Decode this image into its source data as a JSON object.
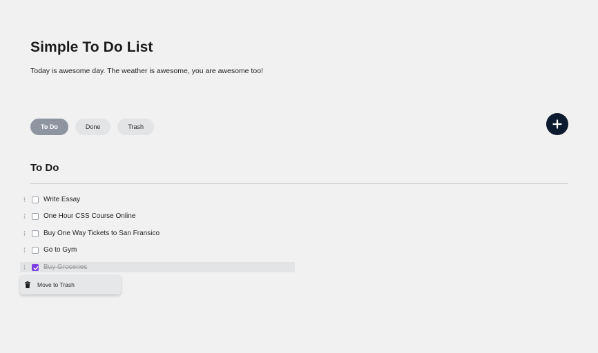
{
  "header": {
    "title": "Simple To Do List",
    "subtitle": "Today is awesome day. The weather is awesome, you are awesome too!"
  },
  "tabs": [
    {
      "label": "To Do",
      "active": true
    },
    {
      "label": "Done",
      "active": false
    },
    {
      "label": "Trash",
      "active": false
    }
  ],
  "add_button": {
    "icon": "plus-icon"
  },
  "section": {
    "title": "To Do"
  },
  "tasks": [
    {
      "label": "Write Essay",
      "checked": false
    },
    {
      "label": "One Hour CSS Course Online",
      "checked": false
    },
    {
      "label": "Buy One Way Tickets to San Fransico",
      "checked": false
    },
    {
      "label": "Go to Gym",
      "checked": false
    },
    {
      "label": "Buy Groceries",
      "checked": true
    }
  ],
  "context_menu": {
    "icon": "trash-icon",
    "label": "Move to Trash"
  },
  "colors": {
    "background": "#f1f1f1",
    "accent": "#7b3fe4",
    "add_button": "#0d1b2e",
    "active_tab": "#8e95a1",
    "inactive_tab": "#e3e4e6"
  }
}
